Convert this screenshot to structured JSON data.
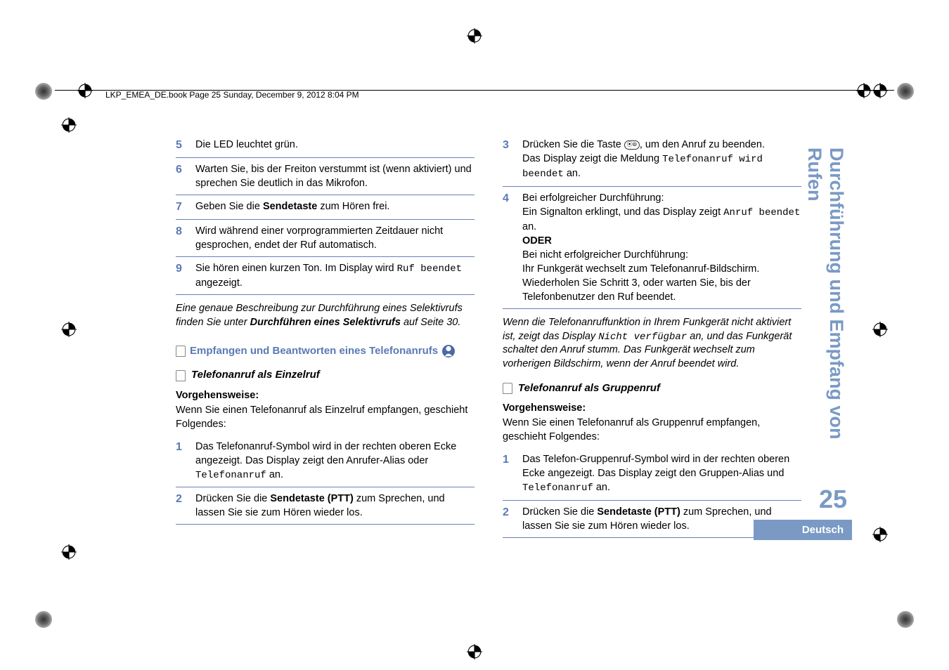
{
  "header": {
    "filename": "LKP_EMEA_DE.book  Page 25  Sunday, December 9, 2012  8:04 PM"
  },
  "left": {
    "step5": "Die LED leuchtet grün.",
    "step6": "Warten Sie, bis der Freiton verstummt ist (wenn aktiviert) und sprechen Sie deutlich in das Mikrofon.",
    "step7_pre": "Geben Sie die ",
    "step7_bold": "Sendetaste",
    "step7_post": " zum Hören frei.",
    "step8": "Wird während einer vorprogrammierten Zeitdauer nicht gesprochen, endet der Ruf automatisch.",
    "step9_pre": "Sie hören einen kurzen Ton. Im Display wird ",
    "step9_mono": "Ruf beendet",
    "step9_post": " angezeigt.",
    "note_pre": "Eine genaue Beschreibung zur Durchführung eines Selektivrufs finden Sie unter ",
    "note_bold": "Durchführen eines Selektivrufs",
    "note_post": " auf Seite 30.",
    "section": "Empfangen und Beantworten eines Telefonanrufs",
    "sub": "Telefonanruf als Einzelruf",
    "proc_label": "Vorgehensweise:",
    "proc_text": "Wenn Sie einen Telefonanruf als Einzelruf empfangen, geschieht Folgendes:",
    "a1_pre": "Das Telefonanruf-Symbol wird in der rechten oberen Ecke angezeigt. Das Display zeigt den Anrufer-Alias oder ",
    "a1_mono": "Telefonanruf",
    "a1_post": " an.",
    "a2_pre": "Drücken Sie die ",
    "a2_bold": "Sendetaste (PTT)",
    "a2_post": " zum Sprechen, und lassen Sie sie zum Hören wieder los."
  },
  "right": {
    "b3_pre": "Drücken Sie die Taste ",
    "b3_post": ", um den Anruf zu beenden.",
    "b3_l2_pre": "Das Display zeigt die Meldung ",
    "b3_l2_mono": "Telefonanruf wird beendet",
    "b3_l2_post": " an.",
    "b4_l1": "Bei erfolgreicher Durchführung:",
    "b4_l2_pre": "Ein Signalton erklingt, und das Display zeigt ",
    "b4_l2_mono": "Anruf beendet",
    "b4_l2_post": " an.",
    "b4_oder": "ODER",
    "b4_l3": "Bei nicht erfolgreicher Durchführung:",
    "b4_l4": "Ihr Funkgerät wechselt zum Telefonanruf-Bildschirm. Wiederholen Sie Schritt 3, oder warten Sie, bis der Telefonbenutzer den Ruf beendet.",
    "note_pre": "Wenn die Telefonanruffunktion in Ihrem Funkgerät nicht aktiviert ist, zeigt das Display ",
    "note_mono": "Nicht verfügbar",
    "note_post": " an, und das Funkgerät schaltet den Anruf stumm. Das Funkgerät wechselt zum vorherigen Bildschirm, wenn der Anruf beendet wird.",
    "sub": "Telefonanruf als Gruppenruf",
    "proc_label": "Vorgehensweise:",
    "proc_text": "Wenn Sie einen Telefonanruf als Gruppenruf empfangen, geschieht Folgendes:",
    "c1_pre": "Das Telefon-Gruppenruf-Symbol wird in der rechten oberen Ecke angezeigt. Das Display zeigt den Gruppen-Alias und ",
    "c1_mono": "Telefonanruf",
    "c1_post": " an.",
    "c2_pre": "Drücken Sie die ",
    "c2_bold": "Sendetaste (PTT)",
    "c2_post": " zum Sprechen, und lassen Sie sie zum Hören wieder los."
  },
  "side": {
    "title": "Durchführung und Empfang von Rufen",
    "page": "25",
    "lang": "Deutsch"
  },
  "nums": {
    "n5": "5",
    "n6": "6",
    "n7": "7",
    "n8": "8",
    "n9": "9",
    "a1": "1",
    "a2": "2",
    "b3": "3",
    "b4": "4",
    "c1": "1",
    "c2": "2"
  }
}
